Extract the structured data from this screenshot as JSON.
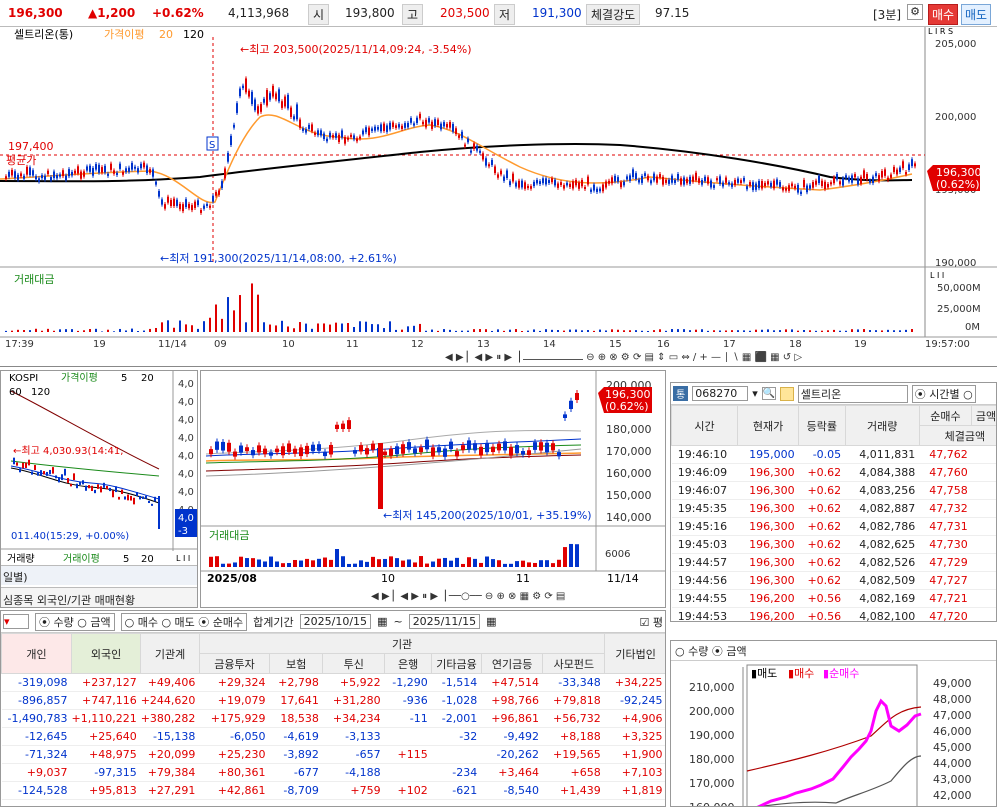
{
  "header": {
    "price": "196,300",
    "change": "▲1,200",
    "change_pct": "+0.62%",
    "volume": "4,113,968",
    "open_label": "시",
    "open": "193,800",
    "high_label": "고",
    "high": "203,500",
    "low_label": "저",
    "low": "191,300",
    "strength_label": "체결강도",
    "strength": "97.15",
    "period": "[3분]",
    "buy": "매수",
    "sell": "매도"
  },
  "main_chart": {
    "stock": "셀트리온(통)",
    "ma_label": "가격이평",
    "ma1": "20",
    "ma2": "120",
    "high_note": "←최고 203,500(2025/11/14,09:24, -3.54%)",
    "low_note": "←최저 191,300(2025/11/14,08:00, +2.61%)",
    "avg_value": "197,400",
    "avg_label": "평균가",
    "price_tag": "196,300",
    "price_tag_pct": "(0.62%)",
    "y_ticks": [
      "205,000",
      "200,000",
      "195,000",
      "190,000"
    ],
    "vol_label": "거래대금",
    "vol_ticks": [
      "50,000M",
      "25,000M",
      "0M"
    ],
    "x_labels": [
      "17:39",
      "19",
      "11/14",
      "09",
      "10",
      "11",
      "12",
      "13",
      "14",
      "15",
      "16",
      "17",
      "18",
      "19",
      "19:57:00"
    ],
    "tag_lrs": "L I R S",
    "tag_li": "L I I"
  },
  "kospi": {
    "title": "KOSPI",
    "ma_label": "가격이평",
    "ma1": "5",
    "ma2": "20",
    "ma3": "60",
    "ma4": "120",
    "y_ticks": [
      "4,0",
      "4,0",
      "4,0",
      "4,0",
      "4,0",
      "4,0",
      "4,0",
      "4,0"
    ],
    "high_note": "←최고 4,030.93(14:41,",
    "low_note": "011.40(15:29, +0.00%)",
    "tag1": "4,0",
    "tag2": "-3",
    "vol_label": "거래량",
    "vol_ma": "거래이평",
    "vol_ma1": "5",
    "vol_ma2": "20",
    "tab1": "일별)",
    "tab2": "심종목 외국인/기관 매매현황"
  },
  "daily": {
    "y_ticks": [
      "200,000",
      "190,000",
      "180,000",
      "170,000",
      "160,000",
      "150,000",
      "140,000"
    ],
    "price_tag": "196,300",
    "price_tag_pct": "(0.62%)",
    "low_note": "←최저 145,200(2025/10/01, +35.19%)",
    "vol_label": "거래대금",
    "vol_tick": "6006",
    "x_labels": [
      "2025/08",
      "10",
      "11",
      "11/14"
    ]
  },
  "trades": {
    "code": "068270",
    "name": "셀트리온",
    "mode": "시간별",
    "cols": [
      "시간",
      "현재가",
      "등락률",
      "거래량",
      "순매수",
      "금액증",
      "체결금액"
    ],
    "rows": [
      [
        "19:46:10",
        "195,000",
        "-0.05",
        "4,011,831",
        "47,762"
      ],
      [
        "19:46:09",
        "196,300",
        "+0.62",
        "4,084,388",
        "47,760"
      ],
      [
        "19:46:07",
        "196,300",
        "+0.62",
        "4,083,256",
        "47,758"
      ],
      [
        "19:45:35",
        "196,300",
        "+0.62",
        "4,082,887",
        "47,732"
      ],
      [
        "19:45:16",
        "196,300",
        "+0.62",
        "4,082,786",
        "47,731"
      ],
      [
        "19:45:03",
        "196,300",
        "+0.62",
        "4,082,625",
        "47,730"
      ],
      [
        "19:44:57",
        "196,300",
        "+0.62",
        "4,082,526",
        "47,729"
      ],
      [
        "19:44:56",
        "196,300",
        "+0.62",
        "4,082,509",
        "47,727"
      ],
      [
        "19:44:55",
        "196,200",
        "+0.56",
        "4,082,169",
        "47,721"
      ],
      [
        "19:44:53",
        "196,200",
        "+0.56",
        "4,082,100",
        "47,720"
      ]
    ]
  },
  "investors": {
    "opt_qty": "수량",
    "opt_amt": "금액",
    "opt_buy": "매수",
    "opt_sell": "매도",
    "opt_net": "순매수",
    "period_label": "합계기간",
    "date_from": "2025/10/15",
    "date_to": "2025/11/15",
    "check": "평",
    "group": "기관",
    "cols": [
      "개인",
      "외국인",
      "기관계",
      "금융투자",
      "보험",
      "투신",
      "은행",
      "기타금융",
      "연기금등",
      "사모펀드",
      "기타법인"
    ],
    "rows": [
      [
        "-319,098",
        "+237,127",
        "+49,406",
        "+29,324",
        "+2,798",
        "+5,922",
        "-1,290",
        "-1,514",
        "+47,514",
        "-33,348",
        "+34,225"
      ],
      [
        "-896,857",
        "+747,116",
        "+244,620",
        "+19,079",
        "17,641",
        "+31,280",
        "-936",
        "-1,028",
        "+98,766",
        "+79,818",
        "-92,245"
      ],
      [
        "-1,490,783",
        "+1,110,221",
        "+380,282",
        "+175,929",
        "18,538",
        "+34,234",
        "-11",
        "-2,001",
        "+96,861",
        "+56,732",
        "+4,906"
      ],
      [
        "-12,645",
        "+25,640",
        "-15,138",
        "-6,050",
        "-4,619",
        "-3,133",
        "",
        "-32",
        "-9,492",
        "+8,188",
        "+3,325"
      ],
      [
        "-71,324",
        "+48,975",
        "+20,099",
        "+25,230",
        "-3,892",
        "-657",
        "+115",
        "",
        "-20,262",
        "+19,565",
        "+1,900"
      ],
      [
        "+9,037",
        "-97,315",
        "+79,384",
        "+80,361",
        "-677",
        "-4,188",
        "",
        "-234",
        "+3,464",
        "+658",
        "+7,103"
      ],
      [
        "-124,528",
        "+95,813",
        "+27,291",
        "+42,861",
        "-8,709",
        "+759",
        "+102",
        "-621",
        "-8,540",
        "+1,439",
        "+1,819"
      ]
    ]
  },
  "mini": {
    "opt_qty": "수량",
    "opt_amt": "금액",
    "legend_sell": "매도",
    "legend_buy": "매수",
    "legend_net": "순매수",
    "y_left": [
      "210,000",
      "200,000",
      "190,000",
      "180,000",
      "170,000",
      "160,000"
    ],
    "y_right": [
      "49,000",
      "48,000",
      "47,000",
      "46,000",
      "45,000",
      "44,000",
      "43,000",
      "42,000"
    ]
  },
  "colors": {
    "up": "#e00000",
    "down": "#0033cc",
    "ma20": "#ff9a2e",
    "ma120": "#000000",
    "net": "#ff00ff"
  }
}
